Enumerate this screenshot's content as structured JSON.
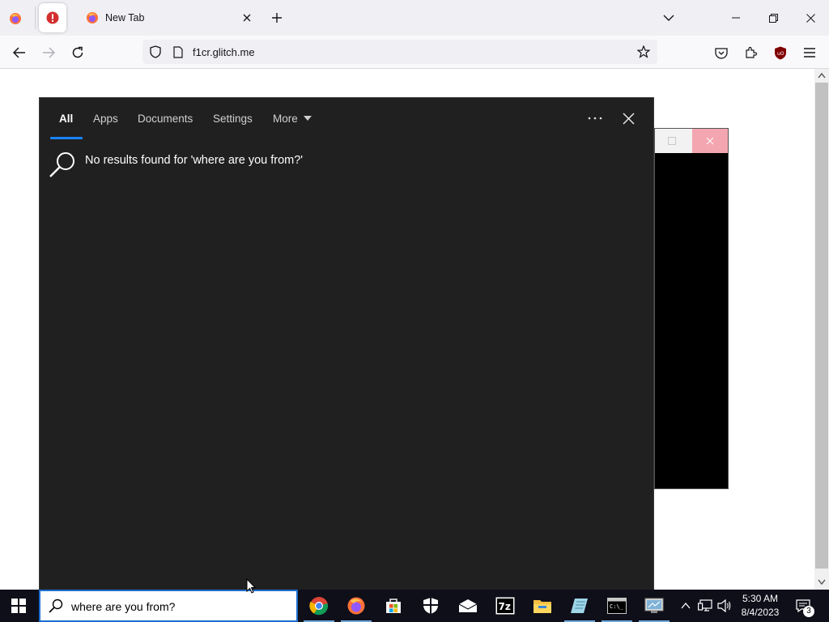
{
  "browser": {
    "tabs": [
      {
        "label": "",
        "icon": "firefox-icon"
      },
      {
        "label": "",
        "icon": "warning-icon"
      },
      {
        "label": "New Tab",
        "icon": "firefox-icon"
      }
    ],
    "url": "f1cr.glitch.me"
  },
  "search_panel": {
    "tabs": [
      "All",
      "Apps",
      "Documents",
      "Settings",
      "More"
    ],
    "active_tab": "All",
    "message": "No results found for 'where are you from?'"
  },
  "taskbar": {
    "search_value": "where are you from?",
    "apps": [
      "chrome-icon",
      "firefox-icon",
      "store-icon",
      "defender-icon",
      "mail-icon",
      "7zip-icon",
      "file-explorer-icon",
      "notepad-icon",
      "terminal-icon",
      "control-panel-icon"
    ],
    "time": "5:30 AM",
    "date": "8/4/2023",
    "notification_count": "3"
  },
  "colors": {
    "accent": "#1a83ff",
    "panel_bg": "#202020",
    "taskbar_bg": "#0f0f1a",
    "warning_red": "#d32f2f"
  }
}
